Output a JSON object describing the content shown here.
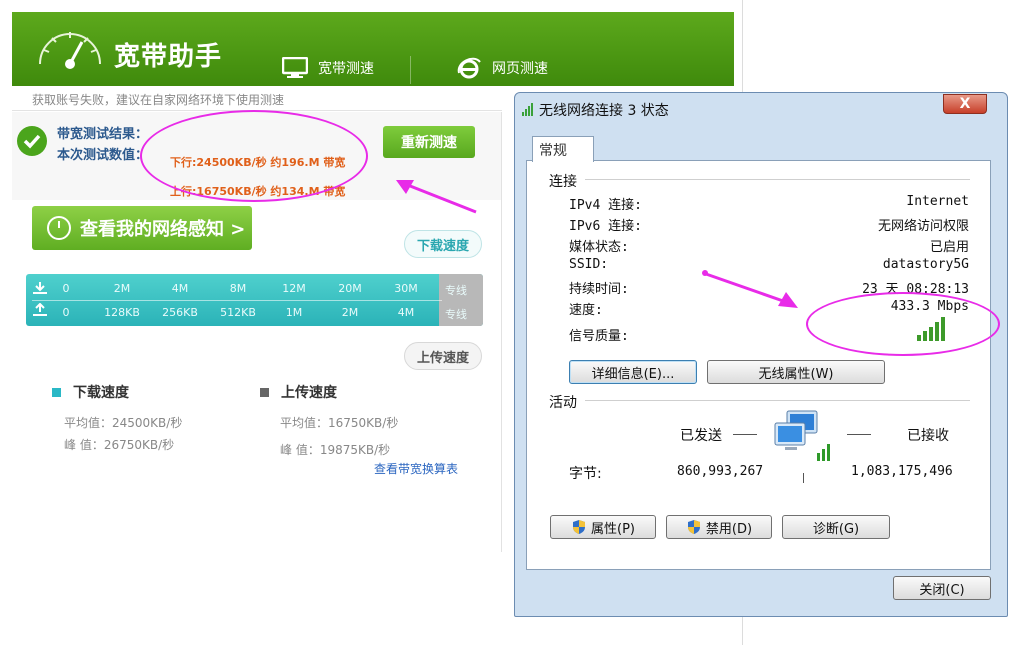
{
  "app": {
    "title": "宽带助手",
    "nav": [
      {
        "label": "宽带测速",
        "icon": "monitor-icon"
      },
      {
        "label": "网页测速",
        "icon": "ie-browser-icon"
      }
    ],
    "notice": "获取账号失败，建议在自家网络环境下使用测速",
    "result": {
      "label1": "带宽测试结果：",
      "label2": "本次测试数值：",
      "download": "下行:24500KB/秒 约196.M 带宽",
      "upload": "上行:16750KB/秒 约134.M 带宽"
    },
    "retest_label": "重新测速",
    "perception_label": "查看我的网络感知 >",
    "download_bubble": "下载速度",
    "upload_bubble": "上传速度",
    "gauge": {
      "download_marks": [
        "0",
        "2M",
        "4M",
        "8M",
        "12M",
        "20M",
        "30M",
        "专线"
      ],
      "upload_marks": [
        "0",
        "128KB",
        "256KB",
        "512KB",
        "1M",
        "2M",
        "4M",
        "专线"
      ]
    },
    "stats": {
      "download_title": "下载速度",
      "download_avg": "平均值：24500KB/秒",
      "download_peak": "峰 值：26750KB/秒",
      "upload_title": "上传速度",
      "upload_avg": "平均值：16750KB/秒",
      "upload_peak": "峰 值：19875KB/秒"
    },
    "bandwidth_link": "查看带宽换算表",
    "colors": {
      "header": "#4e9a14",
      "result_text": "#e0601a",
      "gauge": "#2bb3b8",
      "download_marker": "#2ab8c6",
      "upload_marker": "#666666"
    }
  },
  "dialog": {
    "title": "无线网络连接 3 状态",
    "close_symbol": "X",
    "tab": "常规",
    "connection_group": "连接",
    "rows": [
      {
        "label": "IPv4 连接:",
        "value": "Internet"
      },
      {
        "label": "IPv6 连接:",
        "value": "无网络访问权限"
      },
      {
        "label": "媒体状态:",
        "value": "已启用"
      },
      {
        "label": "SSID:",
        "value": "datastory5G"
      },
      {
        "label": "持续时间:",
        "value": "23 天 08:28:13"
      },
      {
        "label": "速度:",
        "value": "433.3 Mbps"
      }
    ],
    "signal_label": "信号质量:",
    "details_button": "详细信息(E)...",
    "wireless_props_button": "无线属性(W)",
    "activity_group": "活动",
    "sent_label": "已发送",
    "received_label": "已接收",
    "bytes_label": "字节:",
    "bytes_sent": "860,993,267",
    "bytes_received": "1,083,175,496",
    "properties_button": "属性(P)",
    "disable_button": "禁用(D)",
    "diagnose_button": "诊断(G)",
    "close_button": "关闭(C)"
  },
  "annotation_color": "#e82be8"
}
